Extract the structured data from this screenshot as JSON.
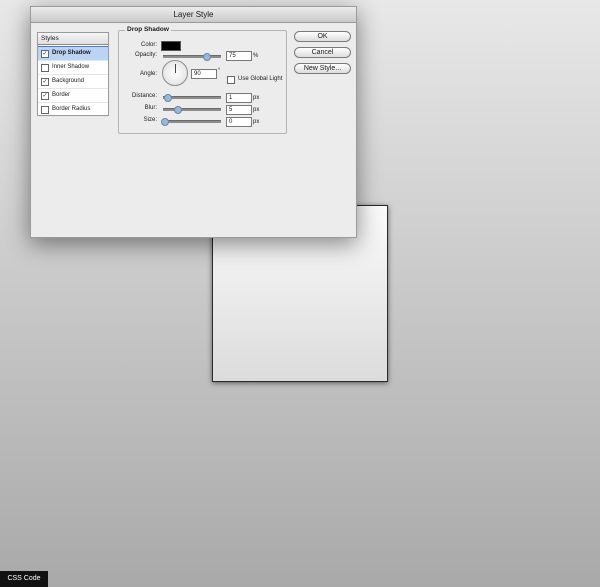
{
  "dialog": {
    "title": "Layer Style"
  },
  "styles_panel": {
    "header": "Styles",
    "items": [
      {
        "label": "Drop Shadow",
        "checked": true,
        "selected": true
      },
      {
        "label": "Inner Shadow",
        "checked": false,
        "selected": false
      },
      {
        "label": "Background",
        "checked": true,
        "selected": false
      },
      {
        "label": "Border",
        "checked": true,
        "selected": false
      },
      {
        "label": "Border Radius",
        "checked": false,
        "selected": false
      }
    ]
  },
  "drop_shadow": {
    "group_title": "Drop Shadow",
    "color_label": "Color:",
    "color_value": "#000000",
    "opacity_label": "Opacity:",
    "opacity_value": "75",
    "opacity_unit": "%",
    "angle_label": "Angle:",
    "angle_value": "90",
    "angle_unit": "°",
    "global_light_label": "Use Global Light",
    "global_light_checked": false,
    "distance_label": "Distance:",
    "distance_value": "1",
    "distance_unit": "px",
    "blur_label": "Blur:",
    "blur_value": "5",
    "blur_unit": "px",
    "size_label": "Size:",
    "size_value": "0",
    "size_unit": "px"
  },
  "buttons": {
    "ok": "OK",
    "cancel": "Cancel",
    "new_style": "New Style..."
  },
  "footer": {
    "css_code": "CSS Code"
  }
}
